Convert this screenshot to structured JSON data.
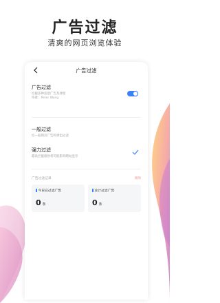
{
  "promo": {
    "headline": "广告过滤",
    "subline": "清爽的网页浏览体验"
  },
  "screen": {
    "nav": {
      "title": "广告过滤"
    },
    "ad_filter": {
      "label": "广告过滤",
      "desc_line1": "拦截多种恶意广告及弹窗",
      "desc_line2": "作者：Peter Wang",
      "enabled": true
    },
    "general": {
      "label": "一般过滤",
      "desc": "拦一般网页广告和弹出过滤"
    },
    "strong": {
      "label": "强力过滤",
      "desc": "最高拦截级别将可能影响网站显示",
      "selected": true
    },
    "records": {
      "heading": "广告过滤记录",
      "clear_label": "清除"
    },
    "stats": [
      {
        "label": "今日已过滤广告",
        "value": "0",
        "unit": "条"
      },
      {
        "label": "总计过滤广告",
        "value": "0",
        "unit": "条"
      }
    ]
  },
  "colors": {
    "accent": "#3b82f6",
    "text": "#222222",
    "muted": "#aaaaaa"
  }
}
